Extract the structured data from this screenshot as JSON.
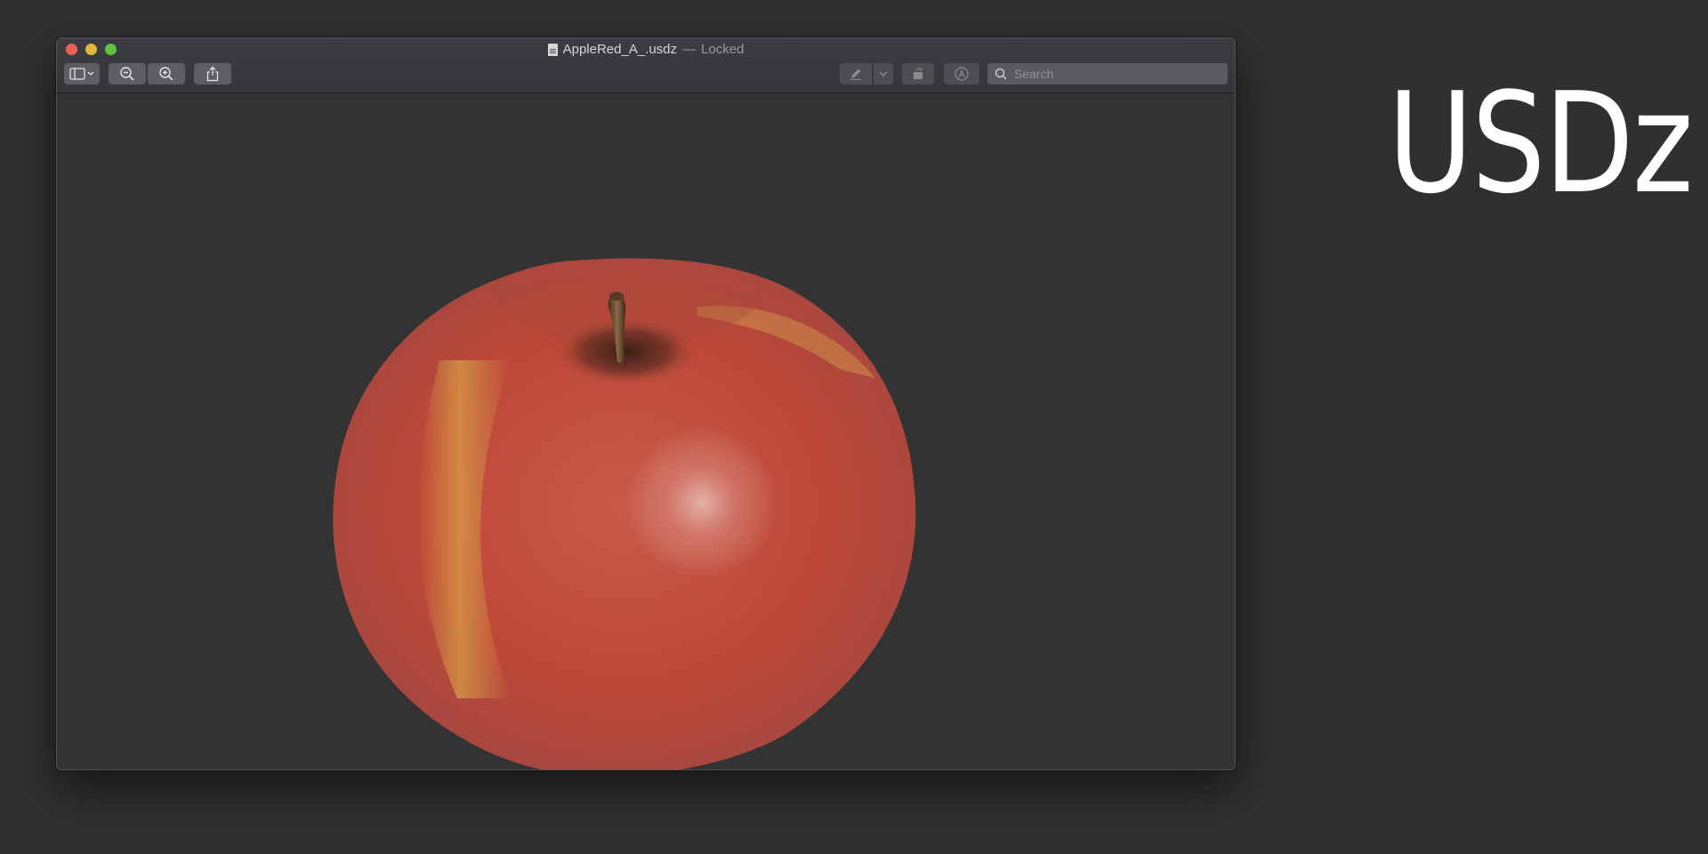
{
  "window": {
    "file_name": "AppleRed_A_.usdz",
    "separator": "—",
    "status": "Locked"
  },
  "toolbar": {
    "sidebar_icon": "sidebar-icon",
    "zoom_out_icon": "zoom-out-icon",
    "zoom_in_icon": "zoom-in-icon",
    "share_icon": "share-icon",
    "markup_icon": "pen-icon",
    "rotate_icon": "rotate-icon",
    "annotate_icon": "markup-icon"
  },
  "search": {
    "placeholder": "Search",
    "value": ""
  },
  "viewer": {
    "model_subject": "red apple 3D model"
  },
  "overlay": {
    "label": "USDz"
  },
  "colors": {
    "background": "#303030",
    "traffic_close": "#ec5f57",
    "traffic_minimize": "#e0b93a",
    "traffic_maximize": "#5ec244",
    "apple_red": "#c0453a",
    "apple_yellow": "#d9a84a"
  }
}
